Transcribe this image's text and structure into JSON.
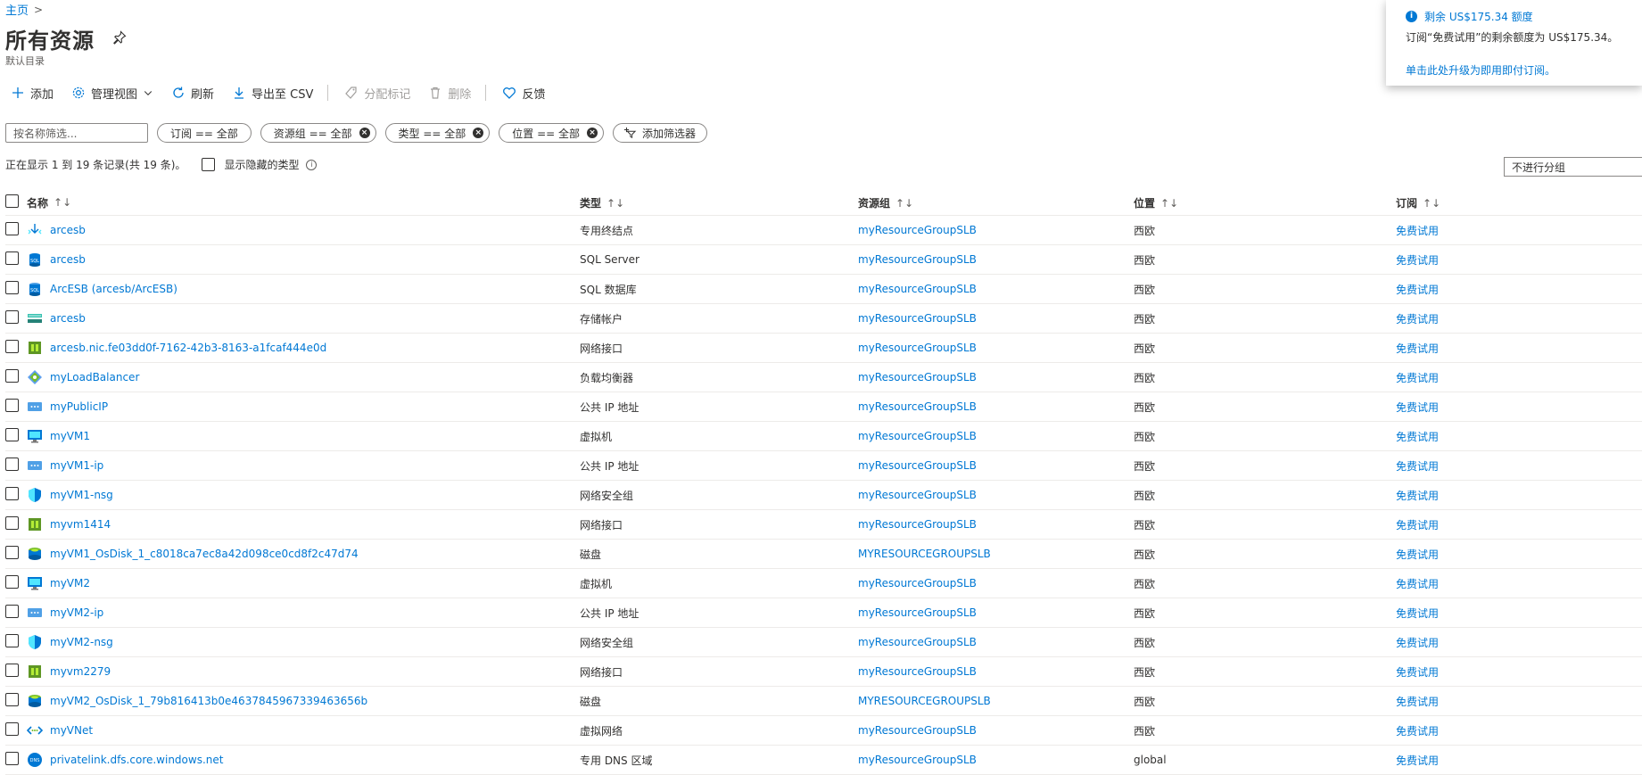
{
  "breadcrumb": {
    "home": "主页",
    "sep": ">"
  },
  "page": {
    "title": "所有资源",
    "subtitle": "默认目录"
  },
  "toolbar": {
    "add": "添加",
    "manage_view": "管理视图",
    "refresh": "刷新",
    "export_csv": "导出至 CSV",
    "assign_tags": "分配标记",
    "delete": "删除",
    "feedback": "反馈"
  },
  "filters": {
    "search_placeholder": "按名称筛选...",
    "subscription": "订阅 == 全部",
    "resource_group": "资源组 == 全部",
    "type": "类型 == 全部",
    "location": "位置 == 全部",
    "add_filter": "添加筛选器"
  },
  "records": {
    "text": "正在显示 1 到 19 条记录(共 19 条)。",
    "show_hidden": "显示隐藏的类型",
    "grouping": "不进行分组"
  },
  "columns": {
    "name": "名称",
    "type": "类型",
    "resource_group": "资源组",
    "location": "位置",
    "subscription": "订阅",
    "sort_icon": "↑↓"
  },
  "rows": [
    {
      "name": "arcesb",
      "type": "专用终结点",
      "rg": "myResourceGroupSLB",
      "loc": "西欧",
      "sub": "免费试用",
      "icon": "private-endpoint"
    },
    {
      "name": "arcesb",
      "type": "SQL Server",
      "rg": "myResourceGroupSLB",
      "loc": "西欧",
      "sub": "免费试用",
      "icon": "sql-server"
    },
    {
      "name": "ArcESB (arcesb/ArcESB)",
      "type": "SQL 数据库",
      "rg": "myResourceGroupSLB",
      "loc": "西欧",
      "sub": "免费试用",
      "icon": "sql-database"
    },
    {
      "name": "arcesb",
      "type": "存储帐户",
      "rg": "myResourceGroupSLB",
      "loc": "西欧",
      "sub": "免费试用",
      "icon": "storage"
    },
    {
      "name": "arcesb.nic.fe03dd0f-7162-42b3-8163-a1fcaf444e0d",
      "type": "网络接口",
      "rg": "myResourceGroupSLB",
      "loc": "西欧",
      "sub": "免费试用",
      "icon": "nic"
    },
    {
      "name": "myLoadBalancer",
      "type": "负载均衡器",
      "rg": "myResourceGroupSLB",
      "loc": "西欧",
      "sub": "免费试用",
      "icon": "load-balancer"
    },
    {
      "name": "myPublicIP",
      "type": "公共 IP 地址",
      "rg": "myResourceGroupSLB",
      "loc": "西欧",
      "sub": "免费试用",
      "icon": "public-ip"
    },
    {
      "name": "myVM1",
      "type": "虚拟机",
      "rg": "myResourceGroupSLB",
      "loc": "西欧",
      "sub": "免费试用",
      "icon": "vm"
    },
    {
      "name": "myVM1-ip",
      "type": "公共 IP 地址",
      "rg": "myResourceGroupSLB",
      "loc": "西欧",
      "sub": "免费试用",
      "icon": "public-ip"
    },
    {
      "name": "myVM1-nsg",
      "type": "网络安全组",
      "rg": "myResourceGroupSLB",
      "loc": "西欧",
      "sub": "免费试用",
      "icon": "nsg"
    },
    {
      "name": "myvm1414",
      "type": "网络接口",
      "rg": "myResourceGroupSLB",
      "loc": "西欧",
      "sub": "免费试用",
      "icon": "nic"
    },
    {
      "name": "myVM1_OsDisk_1_c8018ca7ec8a42d098ce0cd8f2c47d74",
      "type": "磁盘",
      "rg": "MYRESOURCEGROUPSLB",
      "loc": "西欧",
      "sub": "免费试用",
      "icon": "disk"
    },
    {
      "name": "myVM2",
      "type": "虚拟机",
      "rg": "myResourceGroupSLB",
      "loc": "西欧",
      "sub": "免费试用",
      "icon": "vm"
    },
    {
      "name": "myVM2-ip",
      "type": "公共 IP 地址",
      "rg": "myResourceGroupSLB",
      "loc": "西欧",
      "sub": "免费试用",
      "icon": "public-ip"
    },
    {
      "name": "myVM2-nsg",
      "type": "网络安全组",
      "rg": "myResourceGroupSLB",
      "loc": "西欧",
      "sub": "免费试用",
      "icon": "nsg"
    },
    {
      "name": "myvm2279",
      "type": "网络接口",
      "rg": "myResourceGroupSLB",
      "loc": "西欧",
      "sub": "免费试用",
      "icon": "nic"
    },
    {
      "name": "myVM2_OsDisk_1_79b816413b0e4637845967339463656b",
      "type": "磁盘",
      "rg": "MYRESOURCEGROUPSLB",
      "loc": "西欧",
      "sub": "免费试用",
      "icon": "disk"
    },
    {
      "name": "myVNet",
      "type": "虚拟网络",
      "rg": "myResourceGroupSLB",
      "loc": "西欧",
      "sub": "免费试用",
      "icon": "vnet"
    },
    {
      "name": "privatelink.dfs.core.windows.net",
      "type": "专用 DNS 区域",
      "rg": "myResourceGroupSLB",
      "loc": "global",
      "sub": "免费试用",
      "icon": "dns-zone"
    }
  ],
  "notification": {
    "title": "剩余 US$175.34 额度",
    "body": "订阅“免费试用”的剩余额度为 US$175.34。",
    "link": "单击此处升级为即用即付订阅。"
  },
  "colors": {
    "link": "#0078d4",
    "text": "#323130",
    "border": "#edebe9"
  }
}
